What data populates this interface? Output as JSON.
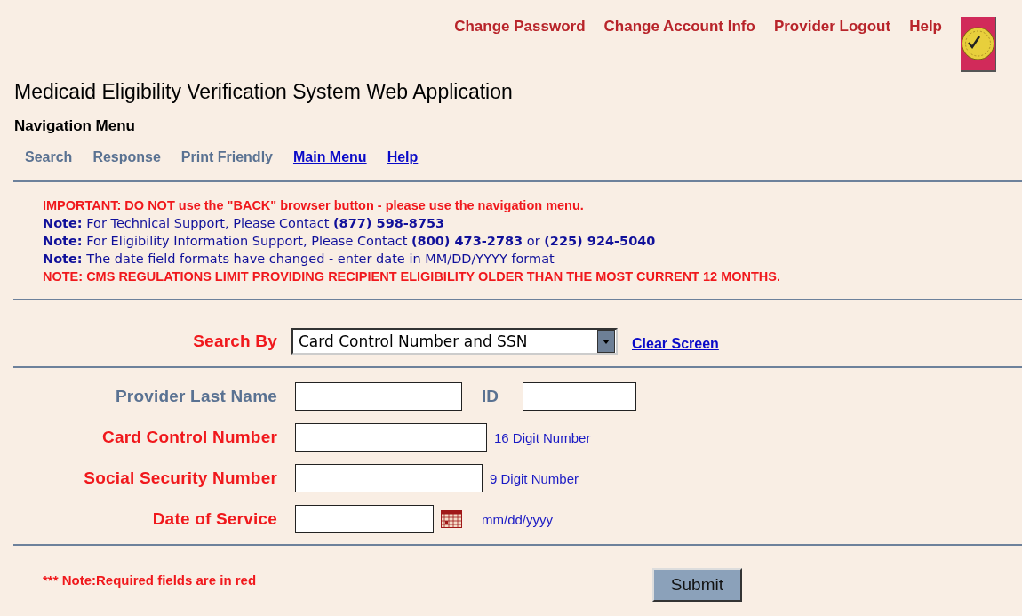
{
  "header_links": [
    "Change Password",
    "Change Account Info",
    "Provider Logout",
    "Help"
  ],
  "title": "Medicaid Eligibility Verification System Web Application",
  "navigation": {
    "heading": "Navigation Menu",
    "items": [
      {
        "label": "Search",
        "kind": "plain"
      },
      {
        "label": "Response",
        "kind": "plain"
      },
      {
        "label": "Print Friendly",
        "kind": "plain"
      },
      {
        "label": "Main Menu",
        "kind": "link"
      },
      {
        "label": "Help",
        "kind": "link"
      }
    ]
  },
  "notices": [
    {
      "kind": "important",
      "text": "IMPORTANT: DO NOT use the \"BACK\" browser button - please use the navigation menu."
    },
    {
      "kind": "note",
      "text": "**Note:** For Technical Support, Please Contact **(877) 598-8753**"
    },
    {
      "kind": "note",
      "text": "**Note:** For Eligibility Information Support, Please Contact **(800) 473-2783** or **(225) 924-5040**"
    },
    {
      "kind": "note",
      "text": "**Note:** The date field formats have changed - enter date in MM/DD/YYYY format"
    },
    {
      "kind": "important",
      "text": "NOTE: CMS REGULATIONS LIMIT PROVIDING RECIPIENT ELIGIBILITY OLDER THAN THE MOST CURRENT 12 MONTHS."
    }
  ],
  "search_by": {
    "label": "Search By",
    "value": "Card Control Number and SSN",
    "link": "Clear Screen"
  },
  "fields": [
    {
      "label": "Provider Last Name",
      "required": false,
      "extra_field": {
        "label": "ID"
      }
    },
    {
      "label": "Card Control Number",
      "required": true,
      "hint": "16 Digit Number"
    },
    {
      "label": "Social Security Number",
      "required": true,
      "hint": "9 Digit Number"
    },
    {
      "label": "Date of Service",
      "required": true,
      "calendar": true,
      "hint": "mm/dd/yyyy"
    }
  ],
  "footer_note": "*** Note:Required fields are in red",
  "submit": "Submit"
}
